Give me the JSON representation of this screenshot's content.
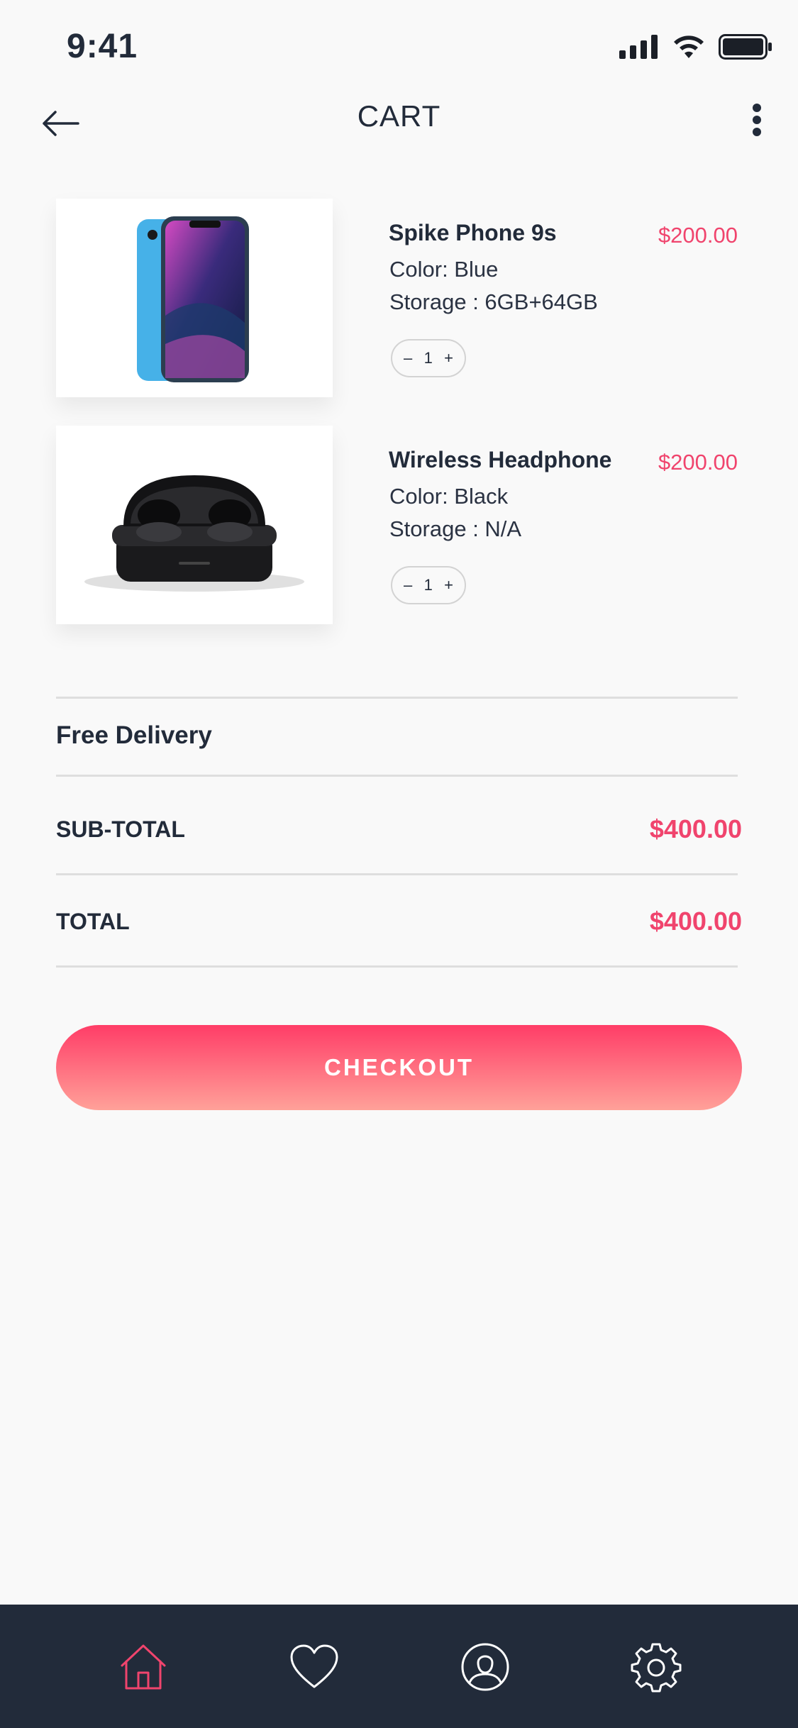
{
  "status_bar": {
    "time": "9:41"
  },
  "header": {
    "title": "CART"
  },
  "cart": {
    "items": [
      {
        "name": "Spike Phone 9s",
        "price": "$200.00",
        "color": "Color: Blue",
        "storage": "Storage : 6GB+64GB",
        "quantity": "1"
      },
      {
        "name": "Wireless Headphone",
        "price": "$200.00",
        "color": "Color: Black",
        "storage": "Storage : N/A",
        "quantity": "1"
      }
    ],
    "qty_decrement": "–",
    "qty_increment": "+"
  },
  "summary": {
    "delivery": "Free Delivery",
    "subtotal_label": "SUB-TOTAL",
    "subtotal_value": "$400.00",
    "total_label": "TOTAL",
    "total_value": "$400.00"
  },
  "checkout": {
    "label": "CHECKOUT"
  },
  "tab_bar": {
    "icons": [
      "home-icon",
      "heart-icon",
      "user-icon",
      "gear-icon"
    ],
    "active": "home-icon",
    "active_color": "#f0446d"
  },
  "colors": {
    "accent": "#f0446d",
    "dark": "#222b3a"
  }
}
